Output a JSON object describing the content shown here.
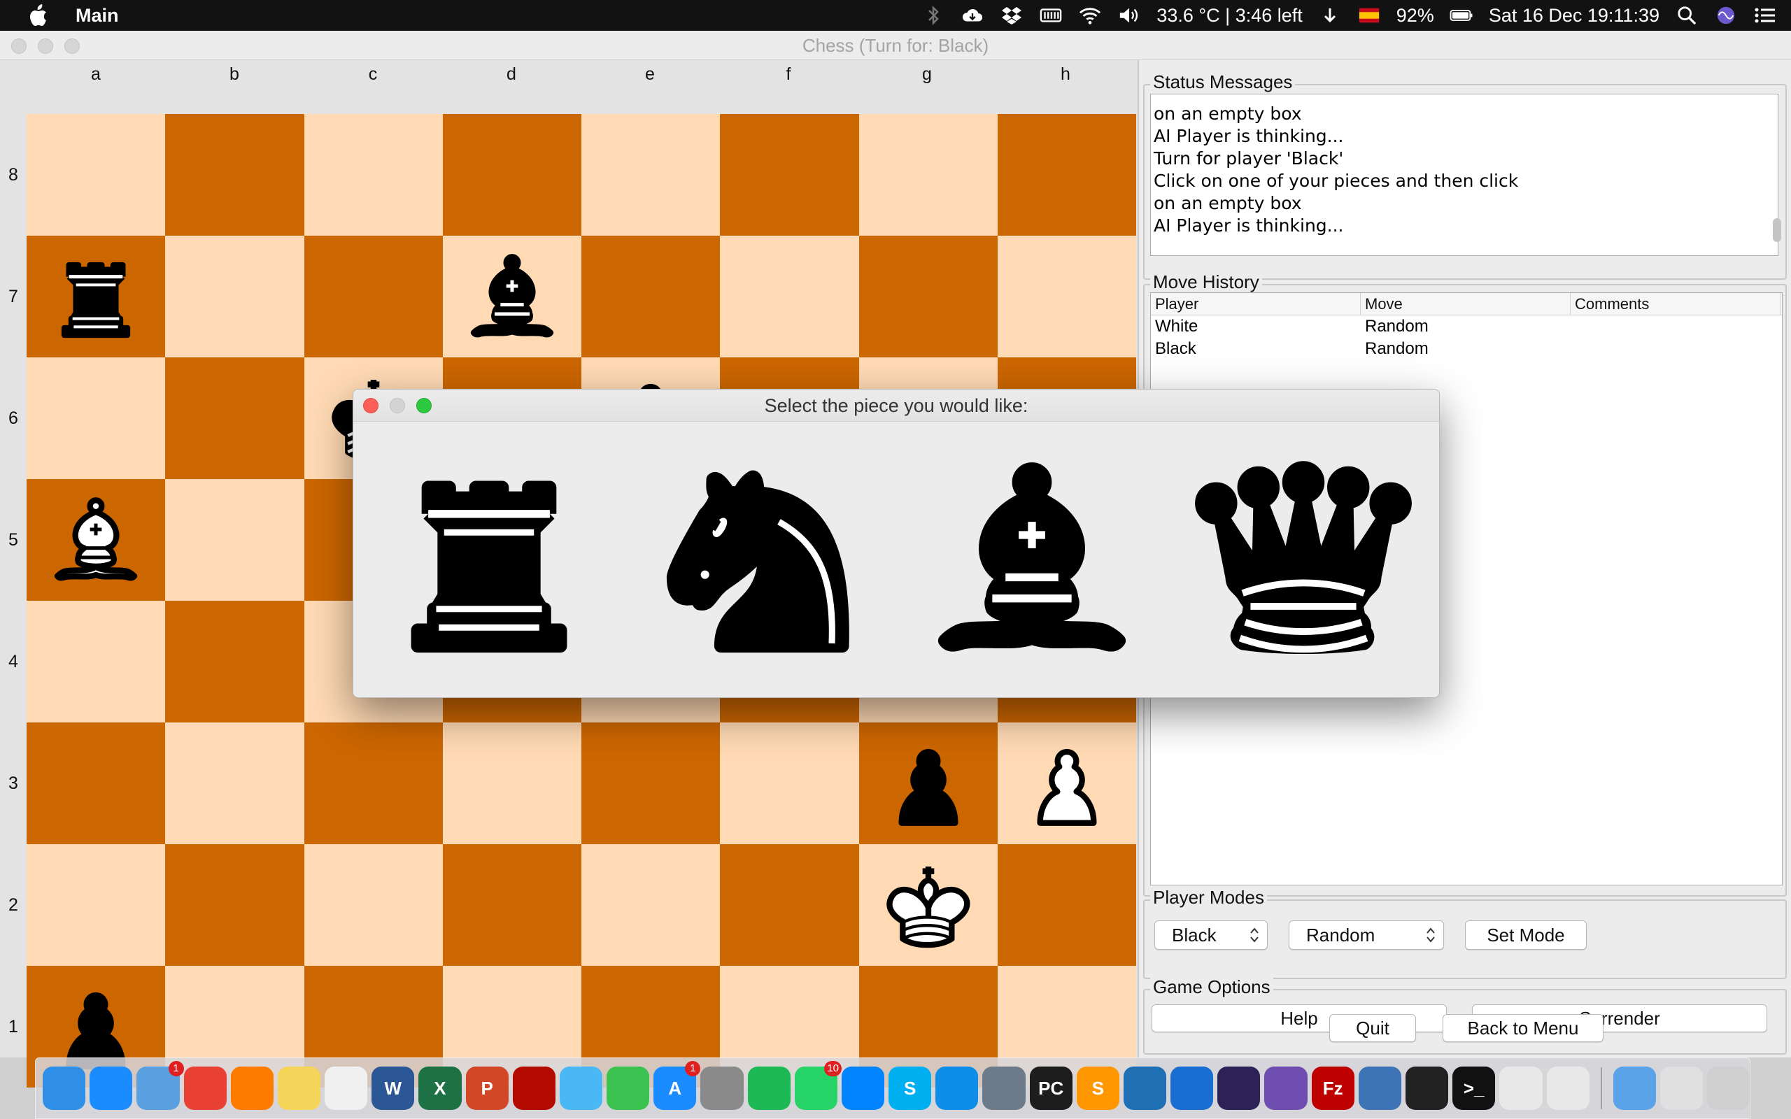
{
  "menubar": {
    "app_name": "Main",
    "temperature_battery_time": "33.6 °C | 3:46 left",
    "battery_percent": "92%",
    "datetime": "Sat 16 Dec  19:11:39",
    "icons": [
      "apple-icon",
      "bluetooth-icon",
      "cloud-icon",
      "dropbox-icon",
      "memory-icon",
      "wifi-icon",
      "volume-icon",
      "battery-icon",
      "flag-icon",
      "spotlight-icon",
      "siri-icon",
      "notification-center-icon"
    ]
  },
  "window": {
    "title": "Chess (Turn for: Black)"
  },
  "board": {
    "files": [
      "a",
      "b",
      "c",
      "d",
      "e",
      "f",
      "g",
      "h"
    ],
    "ranks": [
      "8",
      "7",
      "6",
      "5",
      "4",
      "3",
      "2",
      "1"
    ],
    "light_color": "#ffdab4",
    "dark_color": "#cc6600",
    "pieces": [
      {
        "square": "a7",
        "type": "rook",
        "color": "black"
      },
      {
        "square": "d7",
        "type": "bishop",
        "color": "black"
      },
      {
        "square": "c6",
        "type": "king",
        "color": "black"
      },
      {
        "square": "e6",
        "type": "pawn",
        "color": "black"
      },
      {
        "square": "a5",
        "type": "bishop",
        "color": "white"
      },
      {
        "square": "g3",
        "type": "pawn",
        "color": "black"
      },
      {
        "square": "h3",
        "type": "pawn",
        "color": "white"
      },
      {
        "square": "g2",
        "type": "king",
        "color": "white"
      },
      {
        "square": "a1",
        "type": "pawn",
        "color": "black"
      }
    ]
  },
  "status": {
    "legend": "Status Messages",
    "lines": [
      "on an empty box",
      "AI Player is thinking...",
      "Turn for player 'Black'",
      "Click on one of your pieces and then click",
      "on an empty box",
      "AI Player is thinking..."
    ]
  },
  "history": {
    "legend": "Move History",
    "columns": [
      "Player",
      "Move",
      "Comments"
    ],
    "rows": [
      [
        "White",
        "Random",
        ""
      ],
      [
        "Black",
        "Random",
        ""
      ]
    ]
  },
  "modes": {
    "legend": "Player Modes",
    "player_select": "Black",
    "mode_select": "Random",
    "set_mode_label": "Set Mode"
  },
  "options": {
    "legend": "Game Options",
    "help_label": "Help",
    "surrender_label": "Surrender"
  },
  "footer": {
    "quit_label": "Quit",
    "back_label": "Back to Menu"
  },
  "promotion": {
    "title": "Select the piece you would like:",
    "options": [
      "rook",
      "knight",
      "bishop",
      "queen"
    ]
  },
  "dock": {
    "apps": [
      {
        "name": "Finder",
        "color": "#2f8fe6",
        "glyph": ""
      },
      {
        "name": "Safari",
        "color": "#1a8cff",
        "glyph": ""
      },
      {
        "name": "Mail",
        "color": "#5aa0e0",
        "glyph": "",
        "badge": "1"
      },
      {
        "name": "Chrome",
        "color": "#e94235",
        "glyph": ""
      },
      {
        "name": "Firefox",
        "color": "#ff7b00",
        "glyph": ""
      },
      {
        "name": "Notes",
        "color": "#f5d45a",
        "glyph": ""
      },
      {
        "name": "TextEdit",
        "color": "#f0f0f0",
        "glyph": ""
      },
      {
        "name": "Word",
        "color": "#2b5797",
        "glyph": "W"
      },
      {
        "name": "Excel",
        "color": "#1e7145",
        "glyph": "X"
      },
      {
        "name": "PowerPoint",
        "color": "#d24726",
        "glyph": "P"
      },
      {
        "name": "Acrobat",
        "color": "#b30b00",
        "glyph": ""
      },
      {
        "name": "Messages",
        "color": "#4ab8f5",
        "glyph": ""
      },
      {
        "name": "FaceTime",
        "color": "#3bc251",
        "glyph": ""
      },
      {
        "name": "App Store",
        "color": "#1a8cff",
        "glyph": "A",
        "badge": "1"
      },
      {
        "name": "System Preferences",
        "color": "#8a8a8a",
        "glyph": ""
      },
      {
        "name": "Spotify",
        "color": "#1db954",
        "glyph": ""
      },
      {
        "name": "WhatsApp",
        "color": "#25d366",
        "glyph": "",
        "badge": "10"
      },
      {
        "name": "Messenger",
        "color": "#0084ff",
        "glyph": ""
      },
      {
        "name": "Skype",
        "color": "#00aff0",
        "glyph": "S"
      },
      {
        "name": "TeamViewer",
        "color": "#0e8ee9",
        "glyph": ""
      },
      {
        "name": "Utility",
        "color": "#6c7a89",
        "glyph": ""
      },
      {
        "name": "PyCharm",
        "color": "#1d1d1d",
        "glyph": "PC"
      },
      {
        "name": "Sublime Text",
        "color": "#ff9800",
        "glyph": "S"
      },
      {
        "name": "VS Code",
        "color": "#1f6fb5",
        "glyph": ""
      },
      {
        "name": "Xcode",
        "color": "#1b6ed1",
        "glyph": ""
      },
      {
        "name": "Eclipse",
        "color": "#2c2255",
        "glyph": ""
      },
      {
        "name": "GitHub",
        "color": "#6e4fb1",
        "glyph": ""
      },
      {
        "name": "FileZilla",
        "color": "#bf0000",
        "glyph": "Fz"
      },
      {
        "name": "VirtualBox",
        "color": "#3d74b5",
        "glyph": ""
      },
      {
        "name": "Activity Monitor",
        "color": "#222",
        "glyph": ""
      },
      {
        "name": "Terminal",
        "color": "#111",
        "glyph": ">_"
      },
      {
        "name": "Java",
        "color": "#e8e8e8",
        "glyph": ""
      },
      {
        "name": "Java 2",
        "color": "#e8e8e8",
        "glyph": ""
      },
      {
        "name": "Folder",
        "color": "#5aa3e8",
        "glyph": ""
      },
      {
        "name": "Documents",
        "color": "#e0e0e0",
        "glyph": ""
      },
      {
        "name": "Trash",
        "color": "#cfcfcf",
        "glyph": ""
      }
    ]
  }
}
